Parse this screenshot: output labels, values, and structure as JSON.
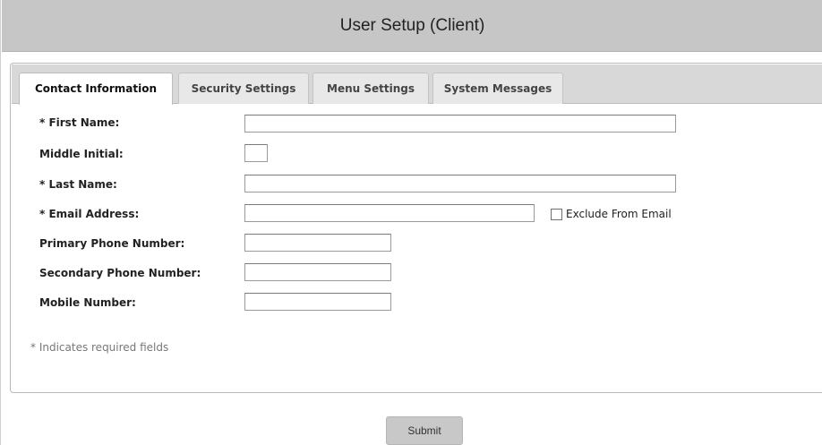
{
  "header": {
    "title": "User Setup (Client)"
  },
  "tabs": [
    {
      "label": "Contact Information",
      "active": true
    },
    {
      "label": "Security Settings",
      "active": false
    },
    {
      "label": "Menu Settings",
      "active": false
    },
    {
      "label": "System Messages",
      "active": false
    }
  ],
  "form": {
    "first_name": {
      "label": "* First Name:",
      "value": ""
    },
    "middle_initial": {
      "label": "Middle Initial:",
      "value": ""
    },
    "last_name": {
      "label": "* Last Name:",
      "value": ""
    },
    "email": {
      "label": "* Email Address:",
      "value": ""
    },
    "exclude_from_email": {
      "label": "Exclude From Email",
      "checked": false
    },
    "primary_phone": {
      "label": "Primary Phone Number:",
      "value": ""
    },
    "secondary_phone": {
      "label": "Secondary Phone Number:",
      "value": ""
    },
    "mobile": {
      "label": "Mobile Number:",
      "value": ""
    },
    "required_note": "* Indicates required fields"
  },
  "actions": {
    "submit_label": "Submit"
  }
}
